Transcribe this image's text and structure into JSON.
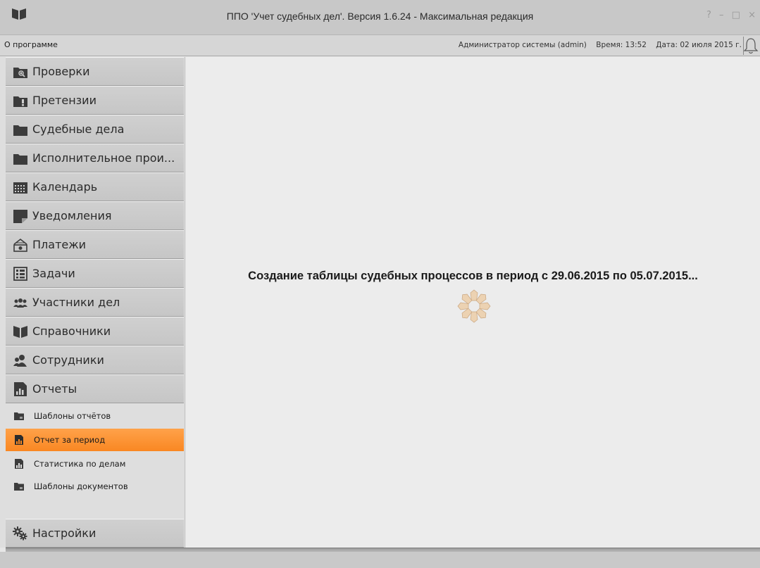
{
  "window": {
    "title": "ППО 'Учет судебных дел'. Версия 1.6.24 - Максимальная редакция",
    "controls": [
      "?",
      "–",
      "□",
      "×"
    ]
  },
  "infobar": {
    "about": "О программе",
    "user": "Администратор системы (admin)",
    "time": "Время: 13:52",
    "date": "Дата: 02 июля 2015 г."
  },
  "sidebar": {
    "items": [
      {
        "label": "Проверки",
        "icon": "folder-search-icon"
      },
      {
        "label": "Претензии",
        "icon": "folder-warning-icon"
      },
      {
        "label": "Судебные дела",
        "icon": "folder-icon"
      },
      {
        "label": "Исполнительное прои...",
        "icon": "folder-icon"
      },
      {
        "label": "Календарь",
        "icon": "calendar-icon"
      },
      {
        "label": "Уведомления",
        "icon": "note-icon"
      },
      {
        "label": "Платежи",
        "icon": "cash-register-icon"
      },
      {
        "label": "Задачи",
        "icon": "task-list-icon"
      },
      {
        "label": "Участники дел",
        "icon": "people-icon"
      },
      {
        "label": "Справочники",
        "icon": "book-icon"
      },
      {
        "label": "Сотрудники",
        "icon": "employee-icon"
      },
      {
        "label": "Отчеты",
        "icon": "report-chart-icon"
      }
    ],
    "sub_items": [
      {
        "label": "Шаблоны отчётов",
        "icon": "template-folder-icon",
        "active": false
      },
      {
        "label": "Отчет за период",
        "icon": "report-chart-icon",
        "active": true
      },
      {
        "label": "Статистика по делам",
        "icon": "report-chart-icon",
        "active": false
      },
      {
        "label": "Шаблоны документов",
        "icon": "template-folder-icon",
        "active": false
      }
    ],
    "settings": {
      "label": "Настройки",
      "icon": "gears-icon"
    }
  },
  "main": {
    "loading_text": "Создание таблицы судебных процессов в период с 29.06.2015 по 05.07.2015..."
  },
  "colors": {
    "active_item": "#f98722",
    "titlebar": "#c8c8c8",
    "main_bg": "#ececec",
    "spinner": "#e8c9a4"
  }
}
